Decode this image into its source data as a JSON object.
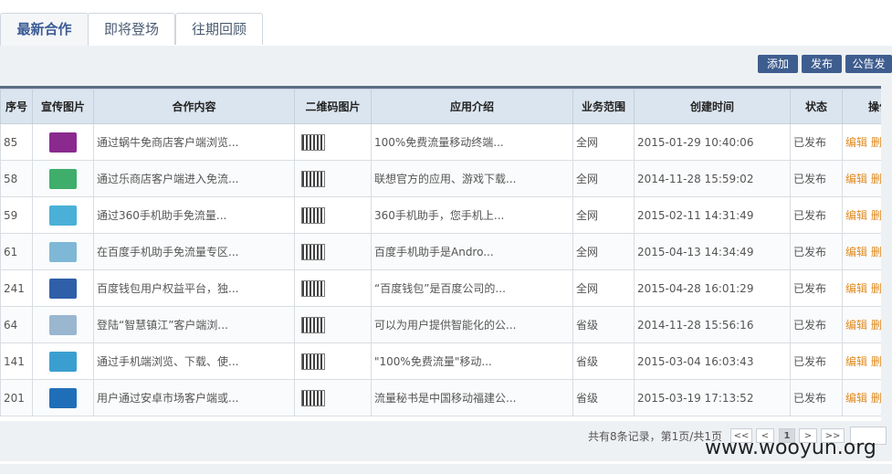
{
  "tabs": [
    {
      "label": "最新合作",
      "active": true
    },
    {
      "label": "即将登场",
      "active": false
    },
    {
      "label": "往期回顾",
      "active": false
    }
  ],
  "toolbar": {
    "add_label": "添加",
    "publish_label": "发布",
    "notice_label": "公告发"
  },
  "table": {
    "headers": [
      "序号",
      "宣传图片",
      "合作内容",
      "二维码图片",
      "应用介绍",
      "业务范围",
      "创建时间",
      "状态",
      "操作"
    ],
    "rows": [
      {
        "id": "85",
        "content": "通过蜗牛免商店客户端浏览...",
        "intro": "100%免费流量移动终端...",
        "scope": "全网",
        "time": "2015-01-29 10:40:06",
        "status": "已发布",
        "color": "#8a2a8e"
      },
      {
        "id": "58",
        "content": "通过乐商店客户端进入免流...",
        "intro": "联想官方的应用、游戏下载...",
        "scope": "全网",
        "time": "2014-11-28 15:59:02",
        "status": "已发布",
        "color": "#3fae6a"
      },
      {
        "id": "59",
        "content": "通过360手机助手免流量...",
        "intro": "360手机助手，您手机上...",
        "scope": "全网",
        "time": "2015-02-11 14:31:49",
        "status": "已发布",
        "color": "#4ab0d8"
      },
      {
        "id": "61",
        "content": "在百度手机助手免流量专区...",
        "intro": "百度手机助手是Andro...",
        "scope": "全网",
        "time": "2015-04-13 14:34:49",
        "status": "已发布",
        "color": "#7fb8d6"
      },
      {
        "id": "241",
        "content": "百度钱包用户权益平台，独...",
        "intro": "“百度钱包”是百度公司的...",
        "scope": "全网",
        "time": "2015-04-28 16:01:29",
        "status": "已发布",
        "color": "#2f5fa8"
      },
      {
        "id": "64",
        "content": "登陆“智慧镇江”客户端浏...",
        "intro": "可以为用户提供智能化的公...",
        "scope": "省级",
        "time": "2014-11-28 15:56:16",
        "status": "已发布",
        "color": "#9ab7d0"
      },
      {
        "id": "141",
        "content": "通过手机端浏览、下载、使...",
        "intro": "\"100%免费流量\"移动...",
        "scope": "省级",
        "time": "2015-03-04 16:03:43",
        "status": "已发布",
        "color": "#3a9fd0"
      },
      {
        "id": "201",
        "content": "用户通过安卓市场客户端或...",
        "intro": "流量秘书是中国移动福建公...",
        "scope": "省级",
        "time": "2015-03-19 17:13:52",
        "status": "已发布",
        "color": "#1f6fb8"
      }
    ],
    "edit_label": "编辑",
    "delete_label": "删"
  },
  "pager": {
    "summary": "共有8条记录，第1页/共1页",
    "first": "<<",
    "prev": "<",
    "current": "1",
    "next": ">",
    "last": ">>"
  },
  "watermark": "www.wooyun.org"
}
